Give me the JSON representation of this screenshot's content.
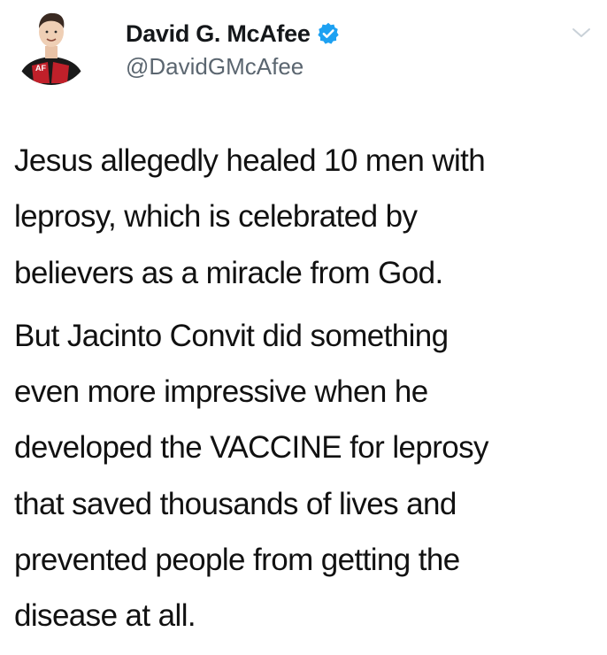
{
  "tweet": {
    "author": {
      "display_name": "David G. McAfee",
      "handle": "@DavidGMcAfee",
      "verified": true,
      "avatar_shirt_text": "AF"
    },
    "paragraphs": [
      "Jesus allegedly healed 10 men with\nleprosy, which is celebrated by\nbelievers as a miracle from God.",
      "But Jacinto Convit did something\neven more impressive when he\ndeveloped the VACCINE for leprosy\nthat saved thousands of lives and\nprevented people from getting the\ndisease at all."
    ],
    "icons": {
      "verified": "verified-badge-icon",
      "menu": "chevron-down-icon"
    },
    "colors": {
      "verified": "#1da1f2",
      "text": "#111111",
      "handle": "#5b6670",
      "background": "#ffffff"
    }
  }
}
